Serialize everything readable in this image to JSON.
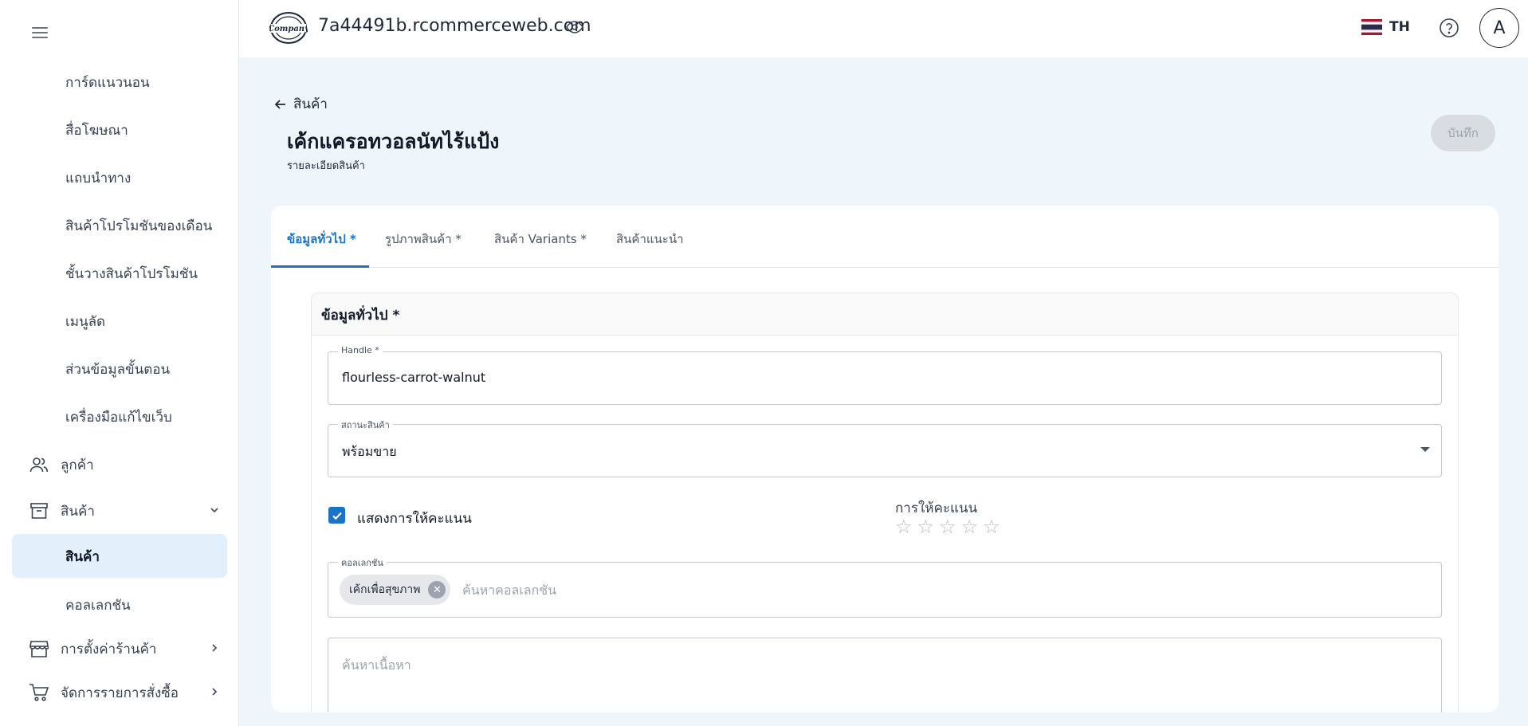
{
  "topbar": {
    "domain": "7a44491b.rcommerceweb.com",
    "logo_text": "Company",
    "language": "TH",
    "avatar_initial": "A"
  },
  "sidebar": {
    "sub_items": [
      {
        "label": "การ์ดแนวนอน"
      },
      {
        "label": "สื่อโฆษณา"
      },
      {
        "label": "แถบนำทาง"
      },
      {
        "label": "สินค้าโปรโมชันของเดือน"
      },
      {
        "label": "ชั้นวางสินค้าโปรโมชัน"
      },
      {
        "label": "เมนูลัด"
      },
      {
        "label": "ส่วนข้อมูลขั้นตอน"
      },
      {
        "label": "เครื่องมือแก้ไขเว็บ"
      }
    ],
    "customers": {
      "label": "ลูกค้า",
      "icon": "users-icon"
    },
    "products": {
      "label": "สินค้า",
      "icon": "archive-box-icon"
    },
    "products_children": [
      {
        "label": "สินค้า",
        "active": true
      },
      {
        "label": "คอลเลกชัน"
      }
    ],
    "store_settings": {
      "label": "การตั้งค่าร้านค้า",
      "icon": "storefront-icon"
    },
    "orders": {
      "label": "จัดการรายการสั่งซื้อ",
      "icon": "cart-icon"
    }
  },
  "header": {
    "back_label": "สินค้า",
    "title": "เค้กแครอทวอลนัทไร้แป้ง",
    "subtitle": "รายละเอียดสินค้า",
    "save_label": "บันทึก"
  },
  "tabs": [
    {
      "label": "ข้อมูลทั่วไป *",
      "active": true
    },
    {
      "label": "รูปภาพสินค้า *"
    },
    {
      "label": "สินค้า Variants *"
    },
    {
      "label": "สินค้าแนะนำ"
    }
  ],
  "form": {
    "section_title": "ข้อมูลทั่วไป *",
    "handle": {
      "label": "Handle *",
      "value": "flourless-carrot-walnut"
    },
    "status": {
      "label": "สถานะสินค้า",
      "value": "พร้อมขาย"
    },
    "show_rating": {
      "label": "แสดงการให้คะแนน",
      "checked": true
    },
    "rating": {
      "label": "การให้คะแนน",
      "value": 0,
      "max": 5
    },
    "collection": {
      "label": "คอลเลกชัน",
      "chips": [
        "เค้กเพื่อสุขภาพ"
      ],
      "placeholder": "ค้นหาคอลเลกชัน"
    },
    "content": {
      "placeholder": "ค้นหาเนื้อหา"
    }
  },
  "colors": {
    "accent": "#1a73c8",
    "active_bg": "#e3f0fb",
    "page_bg": "#eef6fb"
  }
}
